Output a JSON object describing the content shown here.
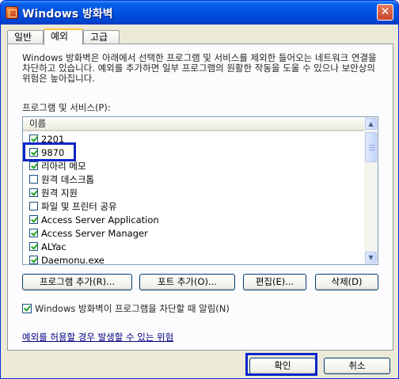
{
  "window": {
    "title": "Windows 방화벽",
    "close_glyph": "✕"
  },
  "tabs": [
    {
      "label": "일반",
      "active": false
    },
    {
      "label": "예외",
      "active": true
    },
    {
      "label": "고급",
      "active": false
    }
  ],
  "exceptions": {
    "description": "Windows 방화벽은 아래에서 선택한 프로그램 및 서비스를 제외한 들어오는 네트워크 연결을 차단하고 있습니다. 예외를 추가하면 일부 프로그램의 원활한 작동을 도울 수 있으나 보안상의 위험은 높아집니다.",
    "list_label": "프로그램 및 서비스(P):",
    "column_header": "이름",
    "items": [
      {
        "label": "2201",
        "checked": true
      },
      {
        "label": "9870",
        "checked": true
      },
      {
        "label": "리아리 메모",
        "checked": true
      },
      {
        "label": "원격 데스크톱",
        "checked": false
      },
      {
        "label": "원격 지원",
        "checked": true
      },
      {
        "label": "파일 및 프린터 공유",
        "checked": false
      },
      {
        "label": "Access Server Application",
        "checked": true
      },
      {
        "label": "Access Server Manager",
        "checked": true
      },
      {
        "label": "ALYac",
        "checked": true
      },
      {
        "label": "Daemonu.exe",
        "checked": true
      }
    ],
    "buttons": {
      "add_program": "프로그램 추가(R)...",
      "add_port": "포트 추가(O)...",
      "edit": "편집(E)...",
      "delete": "삭제(D)"
    },
    "notify": {
      "label": "Windows 방화벽이 프로그램을 차단할 때 알림(N)",
      "checked": true
    },
    "risk_link": "예외를 허용할 경우 발생할 수 있는 위험"
  },
  "footer": {
    "ok": "확인",
    "cancel": "취소"
  },
  "colors": {
    "highlight": "#0a26c8",
    "titlebar": "#0054e3",
    "dialog_bg": "#ece9d8"
  }
}
